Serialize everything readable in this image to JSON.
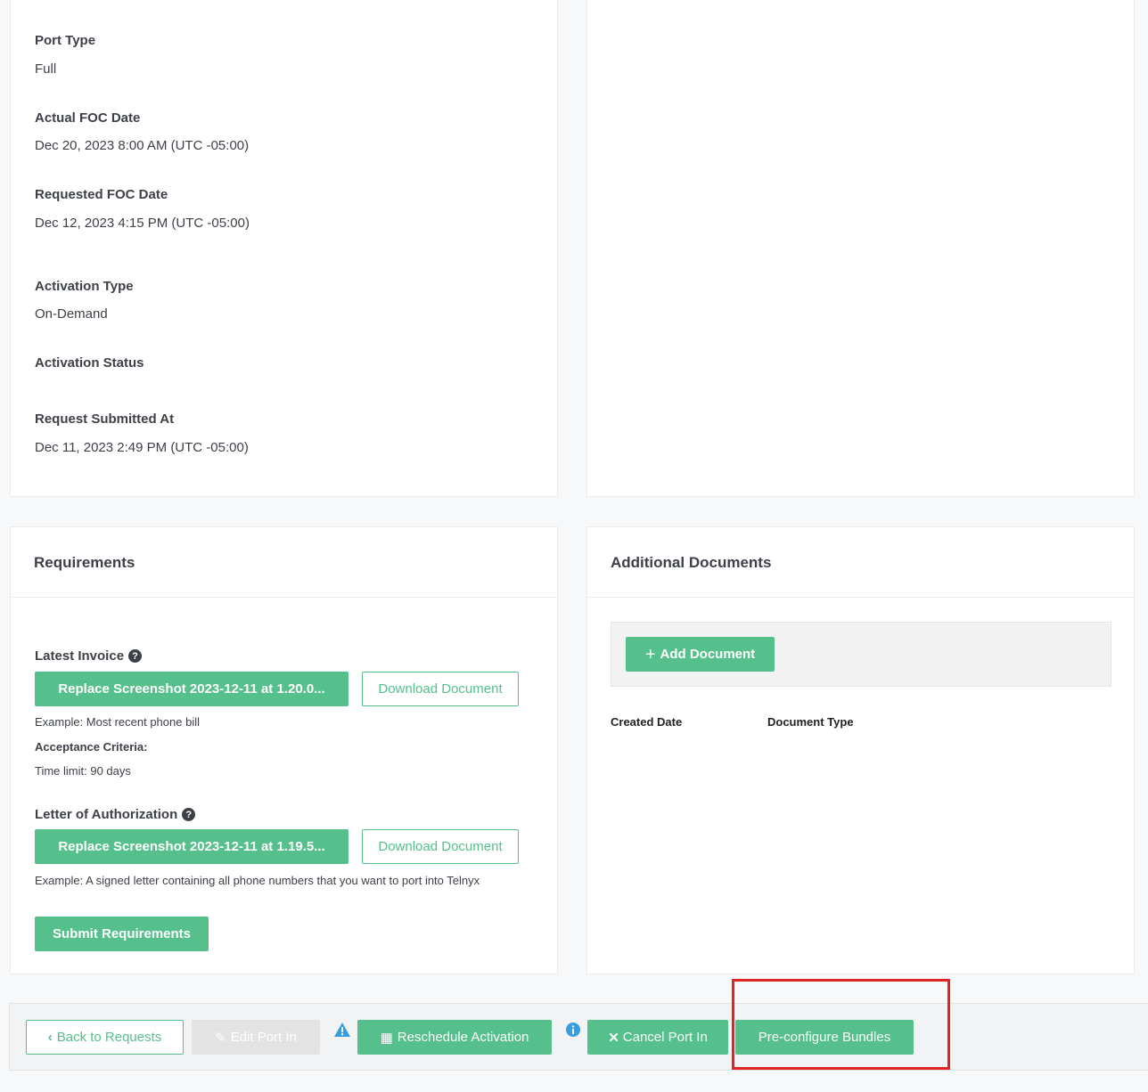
{
  "details": {
    "port_type_label": "Port Type",
    "port_type_value": "Full",
    "actual_foc_label": "Actual FOC Date",
    "actual_foc_value": "Dec 20, 2023 8:00 AM (UTC -05:00)",
    "requested_foc_label": "Requested FOC Date",
    "requested_foc_value": "Dec 12, 2023 4:15 PM (UTC -05:00)",
    "activation_type_label": "Activation Type",
    "activation_type_value": "On-Demand",
    "activation_status_label": "Activation Status",
    "request_submitted_label": "Request Submitted At",
    "request_submitted_value": "Dec 11, 2023 2:49 PM (UTC -05:00)"
  },
  "requirements": {
    "title": "Requirements",
    "latest_invoice_label": "Latest Invoice",
    "latest_invoice_replace": "Replace Screenshot 2023-12-11 at 1.20.0...",
    "download_label": "Download Document",
    "latest_invoice_example": "Example: Most recent phone bill",
    "acceptance_criteria": "Acceptance Criteria:",
    "time_limit": "Time limit: 90 days",
    "loa_label": "Letter of Authorization",
    "loa_replace": "Replace Screenshot 2023-12-11 at 1.19.5...",
    "loa_example": "Example: A signed letter containing all phone numbers that you want to port into Telnyx",
    "submit_label": "Submit Requirements"
  },
  "documents": {
    "title": "Additional Documents",
    "add_label": "Add Document",
    "col_created": "Created Date",
    "col_type": "Document Type"
  },
  "action_bar": {
    "back_label": "Back to Requests",
    "edit_label": "Edit Port In",
    "reschedule_label": "Reschedule Activation",
    "cancel_label": "Cancel Port In",
    "bundles_label": "Pre-configure Bundles"
  },
  "colors": {
    "accent": "#55c08b",
    "highlight": "#e02424",
    "warning": "#3b9ddd"
  }
}
